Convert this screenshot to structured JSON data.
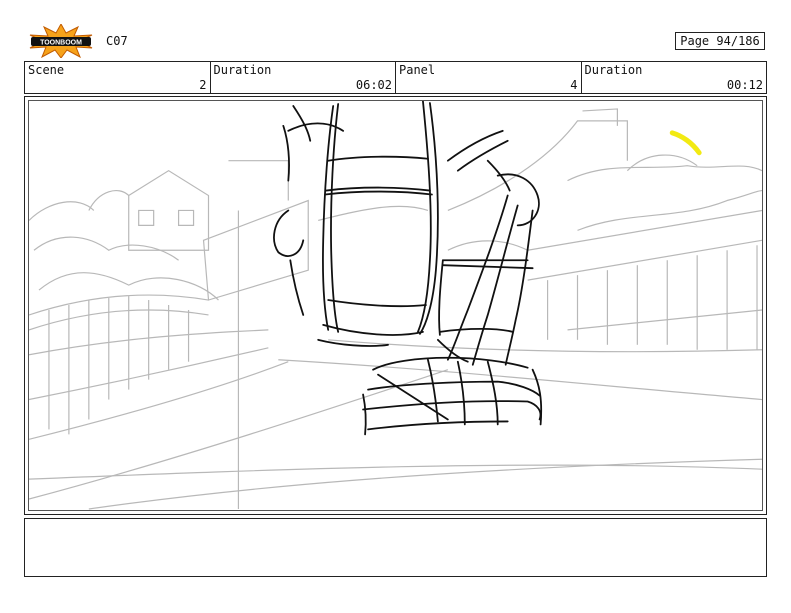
{
  "header": {
    "logo_text": "TOONBOOM",
    "scene_code": "C07",
    "page_label": "Page",
    "page_value": "94/186"
  },
  "info": [
    {
      "label": "Scene",
      "value": "2"
    },
    {
      "label": "Duration",
      "value": "06:02"
    },
    {
      "label": "Panel",
      "value": "4"
    },
    {
      "label": "Duration",
      "value": "00:12"
    }
  ],
  "colors": {
    "sketch_background": "#b8b8b8",
    "sketch_foreground": "#111111",
    "highlight": "#f2ea12",
    "logo_star": "#f6a21a"
  },
  "notes": {
    "text": ""
  }
}
